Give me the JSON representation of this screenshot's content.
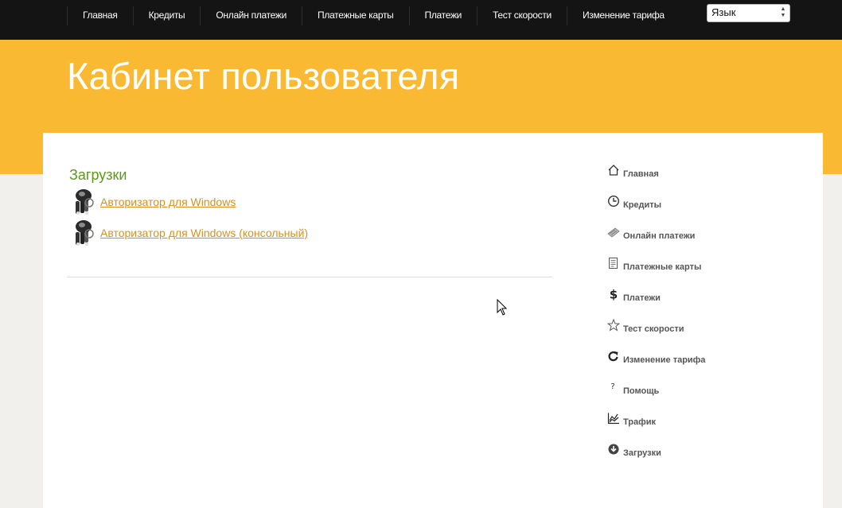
{
  "topnav": {
    "items": [
      {
        "label": "Главная"
      },
      {
        "label": "Кредиты"
      },
      {
        "label": "Онлайн платежи"
      },
      {
        "label": "Платежные карты"
      },
      {
        "label": "Платежи"
      },
      {
        "label": "Тест скорости"
      },
      {
        "label": "Изменение тарифа"
      }
    ],
    "language_select": {
      "value": "Язык"
    }
  },
  "header": {
    "title": "Кабинет пользователя"
  },
  "main": {
    "section_title": "Загрузки",
    "downloads": [
      {
        "label": "Авторизатор для Windows",
        "icon": "keys-icon"
      },
      {
        "label": "Авторизатор для Windows (консольный)",
        "icon": "keys-icon"
      }
    ]
  },
  "sidebar": {
    "items": [
      {
        "label": "Главная",
        "icon": "home-icon"
      },
      {
        "label": "Кредиты",
        "icon": "clock-icon"
      },
      {
        "label": "Онлайн платежи",
        "icon": "payment-card-icon"
      },
      {
        "label": "Платежные карты",
        "icon": "document-icon"
      },
      {
        "label": "Платежи",
        "icon": "dollar-icon"
      },
      {
        "label": "Тест скорости",
        "icon": "star-icon"
      },
      {
        "label": "Изменение тарифа",
        "icon": "refresh-icon"
      },
      {
        "label": "Помощь",
        "icon": "question-icon"
      },
      {
        "label": "Трафик",
        "icon": "chart-icon"
      },
      {
        "label": "Загрузки",
        "icon": "download-icon"
      }
    ]
  },
  "colors": {
    "topbar": "#141414",
    "banner": "#f9b932",
    "section_title": "#5b9a17",
    "link": "#d8901e",
    "sidebar_text": "#555555"
  }
}
